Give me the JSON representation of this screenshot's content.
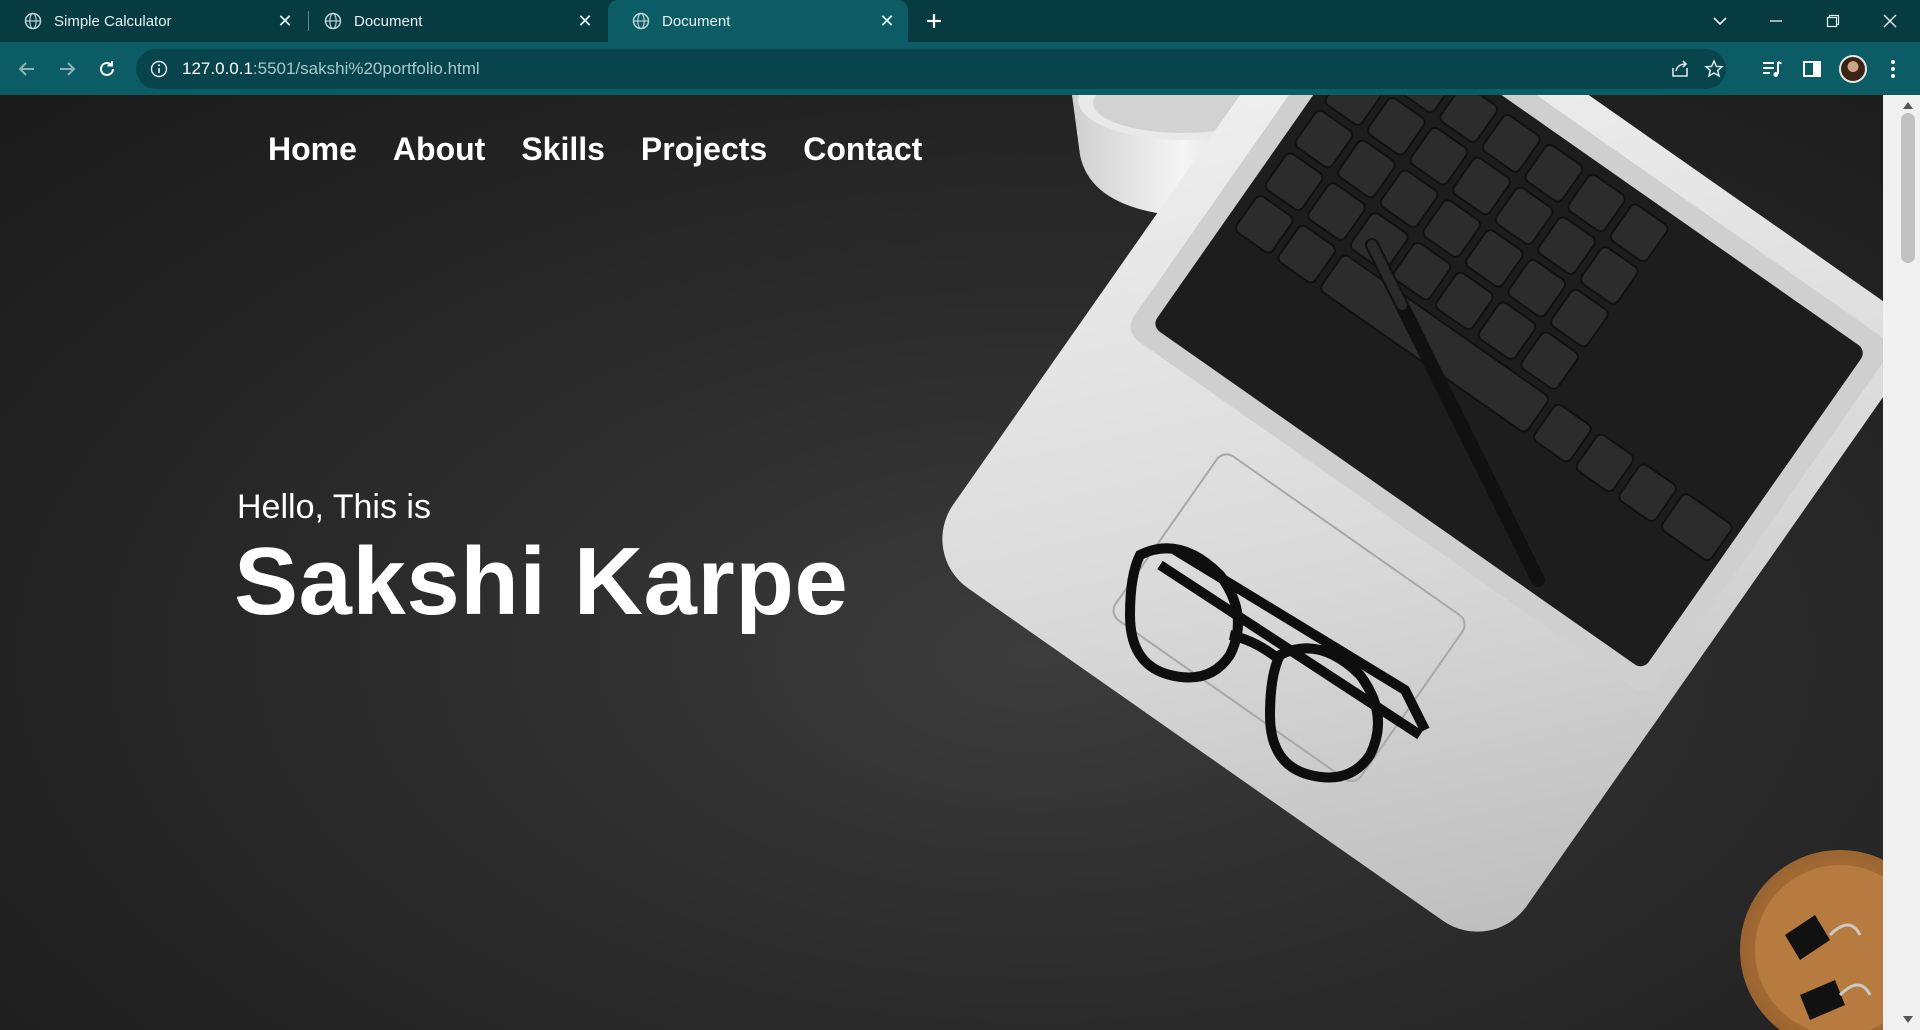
{
  "browser": {
    "tabs": [
      {
        "title": "Simple Calculator",
        "active": false
      },
      {
        "title": "Document",
        "active": false
      },
      {
        "title": "Document",
        "active": true
      }
    ],
    "url_host": "127.0.0.1",
    "url_path": ":5501/sakshi%20portfolio.html"
  },
  "page": {
    "nav": {
      "home": "Home",
      "about": "About",
      "skills": "Skills",
      "projects": "Projects",
      "contact": "Contact"
    },
    "hero": {
      "greeting": "Hello, This is",
      "name": "Sakshi Karpe"
    }
  },
  "colors": {
    "tabbar_bg": "#073b42",
    "toolbar_bg": "#0c5c66",
    "page_bg": "#2b2b2b",
    "hero_text": "#ffffff"
  }
}
